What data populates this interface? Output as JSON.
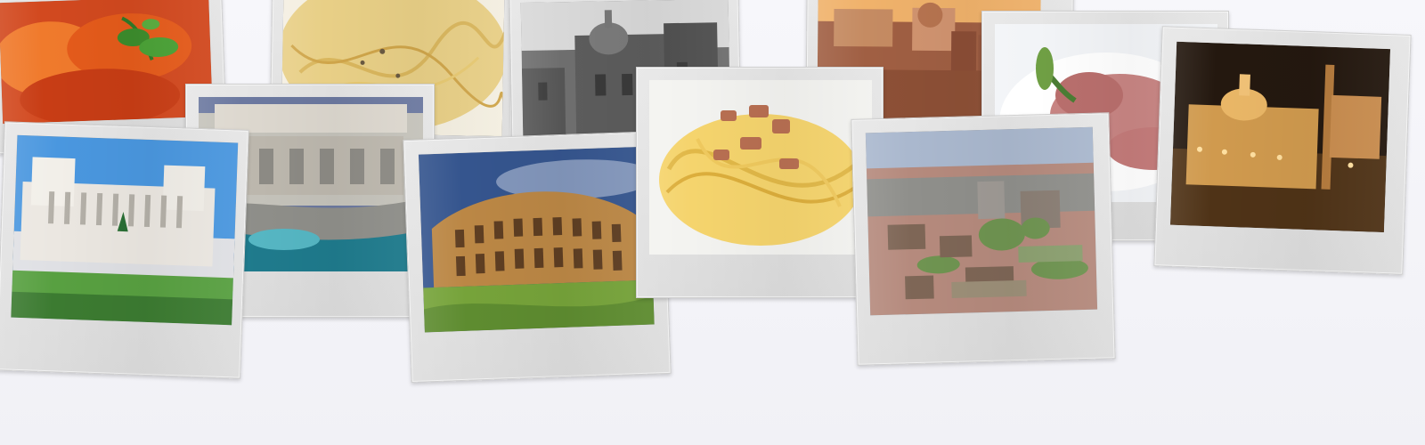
{
  "collage": {
    "photos": [
      {
        "name": "pasta-tomato-photo"
      },
      {
        "name": "spaghetti-cream-photo"
      },
      {
        "name": "old-church-photo"
      },
      {
        "name": "rome-skyline-photo"
      },
      {
        "name": "prosciutto-dish-photo"
      },
      {
        "name": "st-peters-night-photo"
      },
      {
        "name": "trevi-fountain-photo"
      },
      {
        "name": "vittoriano-monument-photo"
      },
      {
        "name": "colosseum-photo"
      },
      {
        "name": "carbonara-photo"
      },
      {
        "name": "roman-forum-photo"
      }
    ]
  }
}
